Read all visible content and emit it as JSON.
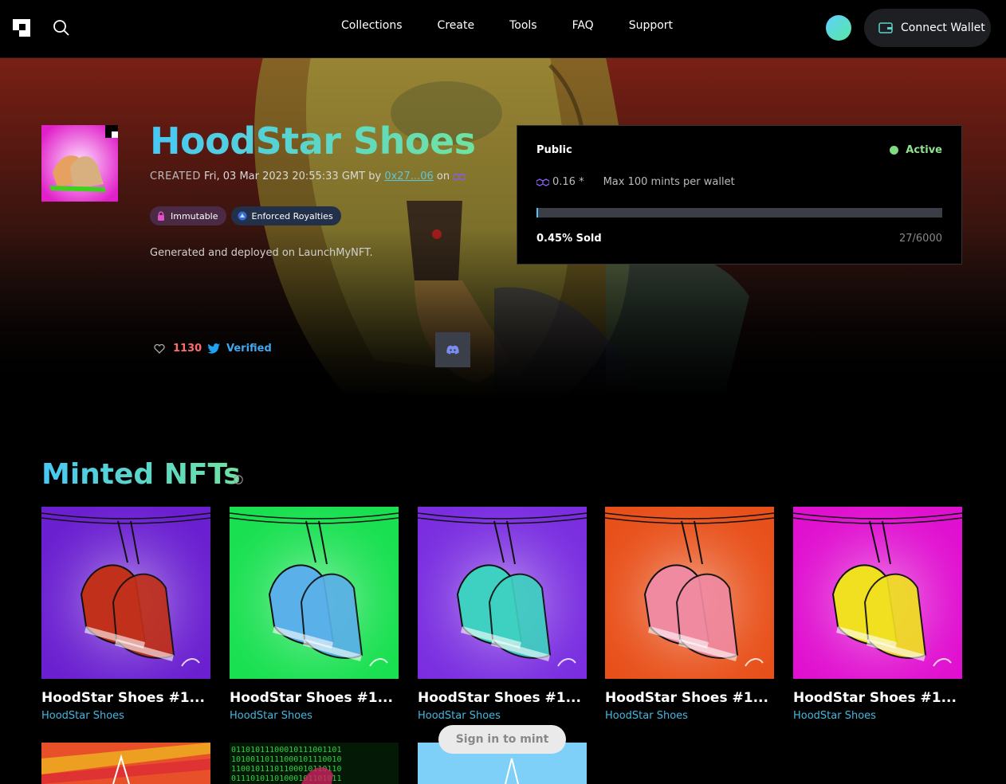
{
  "nav": {
    "links": [
      "Collections",
      "Create",
      "Tools",
      "FAQ",
      "Support"
    ],
    "wallet_label": "Connect Wallet"
  },
  "collection": {
    "title": "HoodStar Shoes",
    "created_label": "CREATED",
    "created_date": "Fri, 03 Mar 2023 20:55:33 GMT",
    "by_label": "by",
    "creator": "0x27...06",
    "on_label": "on",
    "badges": [
      "Immutable",
      "Enforced Royalties"
    ],
    "description": "Generated and deployed on LaunchMyNFT.",
    "likes": "1130",
    "twitter_label": "Verified"
  },
  "mint": {
    "phase": "Public",
    "status": "Active",
    "price": "0.16 *",
    "max_mints": "Max 100 mints per wallet",
    "progress": 0.45,
    "sold_label": "0.45% Sold",
    "count": "27/6000"
  },
  "minted": {
    "title": "Minted NFTs",
    "cards": [
      {
        "name": "HoodStar Shoes #1...",
        "collection": "HoodStar Shoes",
        "bg": "#6a1fd0",
        "shoe": "#c0301a"
      },
      {
        "name": "HoodStar Shoes #1...",
        "collection": "HoodStar Shoes",
        "bg": "#18e050",
        "shoe": "#5ab0e8"
      },
      {
        "name": "HoodStar Shoes #1...",
        "collection": "HoodStar Shoes",
        "bg": "#7a2ee0",
        "shoe": "#3ed0c0"
      },
      {
        "name": "HoodStar Shoes #1...",
        "collection": "HoodStar Shoes",
        "bg": "#e8501a",
        "shoe": "#f08aa0"
      },
      {
        "name": "HoodStar Shoes #1...",
        "collection": "HoodStar Shoes",
        "bg": "#e010d0",
        "shoe": "#f0e020"
      }
    ]
  },
  "signin_label": "Sign in to mint",
  "colors": {
    "accent_start": "#47c8f5",
    "accent_end": "#6fe3a0",
    "active": "#7fdc7f"
  }
}
